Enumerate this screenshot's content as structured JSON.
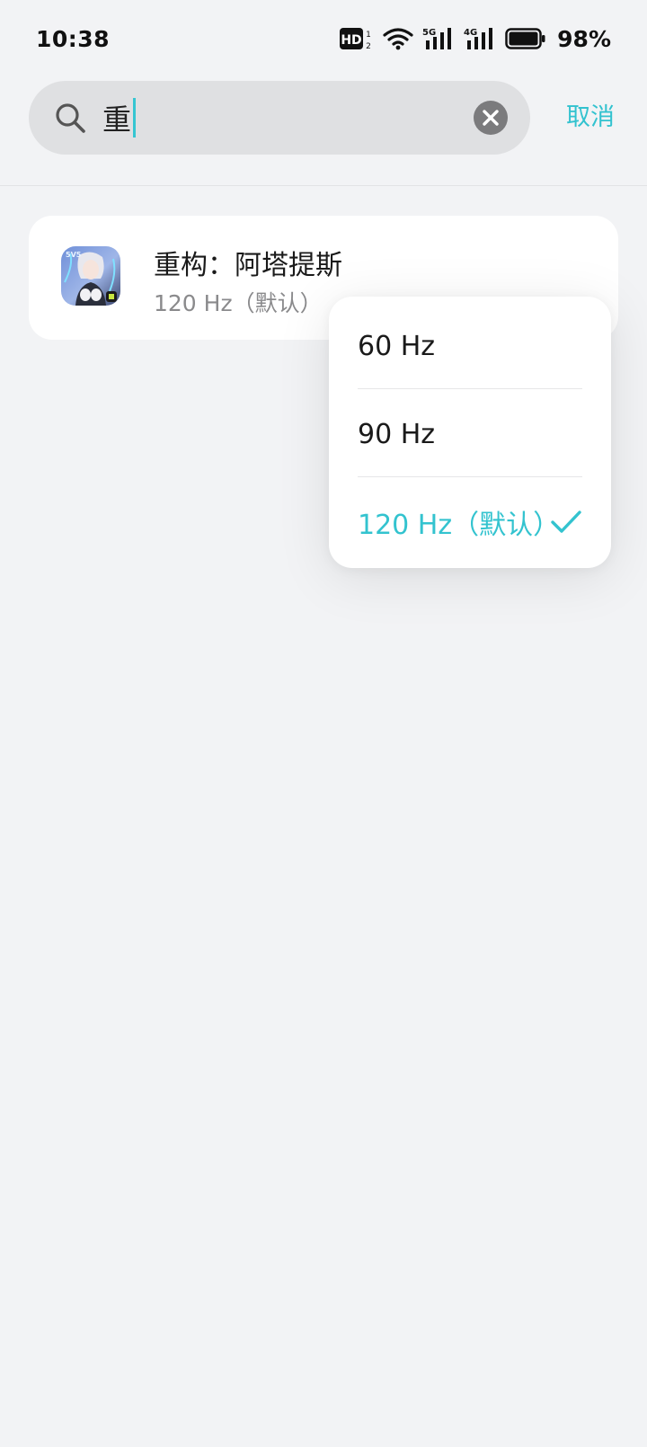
{
  "status_bar": {
    "time": "10:38",
    "battery_percent": "98%",
    "icons": [
      "hd-voice-icon",
      "wifi-icon",
      "signal-5g-icon",
      "signal-4g-icon",
      "battery-icon"
    ]
  },
  "search": {
    "query": "重",
    "cancel_label": "取消"
  },
  "app": {
    "name": "重构：阿塔提斯",
    "refresh_rate": "120 Hz（默认）"
  },
  "dropdown": {
    "options": [
      {
        "label": "60 Hz",
        "selected": false
      },
      {
        "label": "90 Hz",
        "selected": false
      },
      {
        "label": "120 Hz（默认）",
        "selected": true
      }
    ]
  },
  "colors": {
    "accent": "#33c3cf",
    "background": "#f2f3f5",
    "card": "#ffffff"
  }
}
